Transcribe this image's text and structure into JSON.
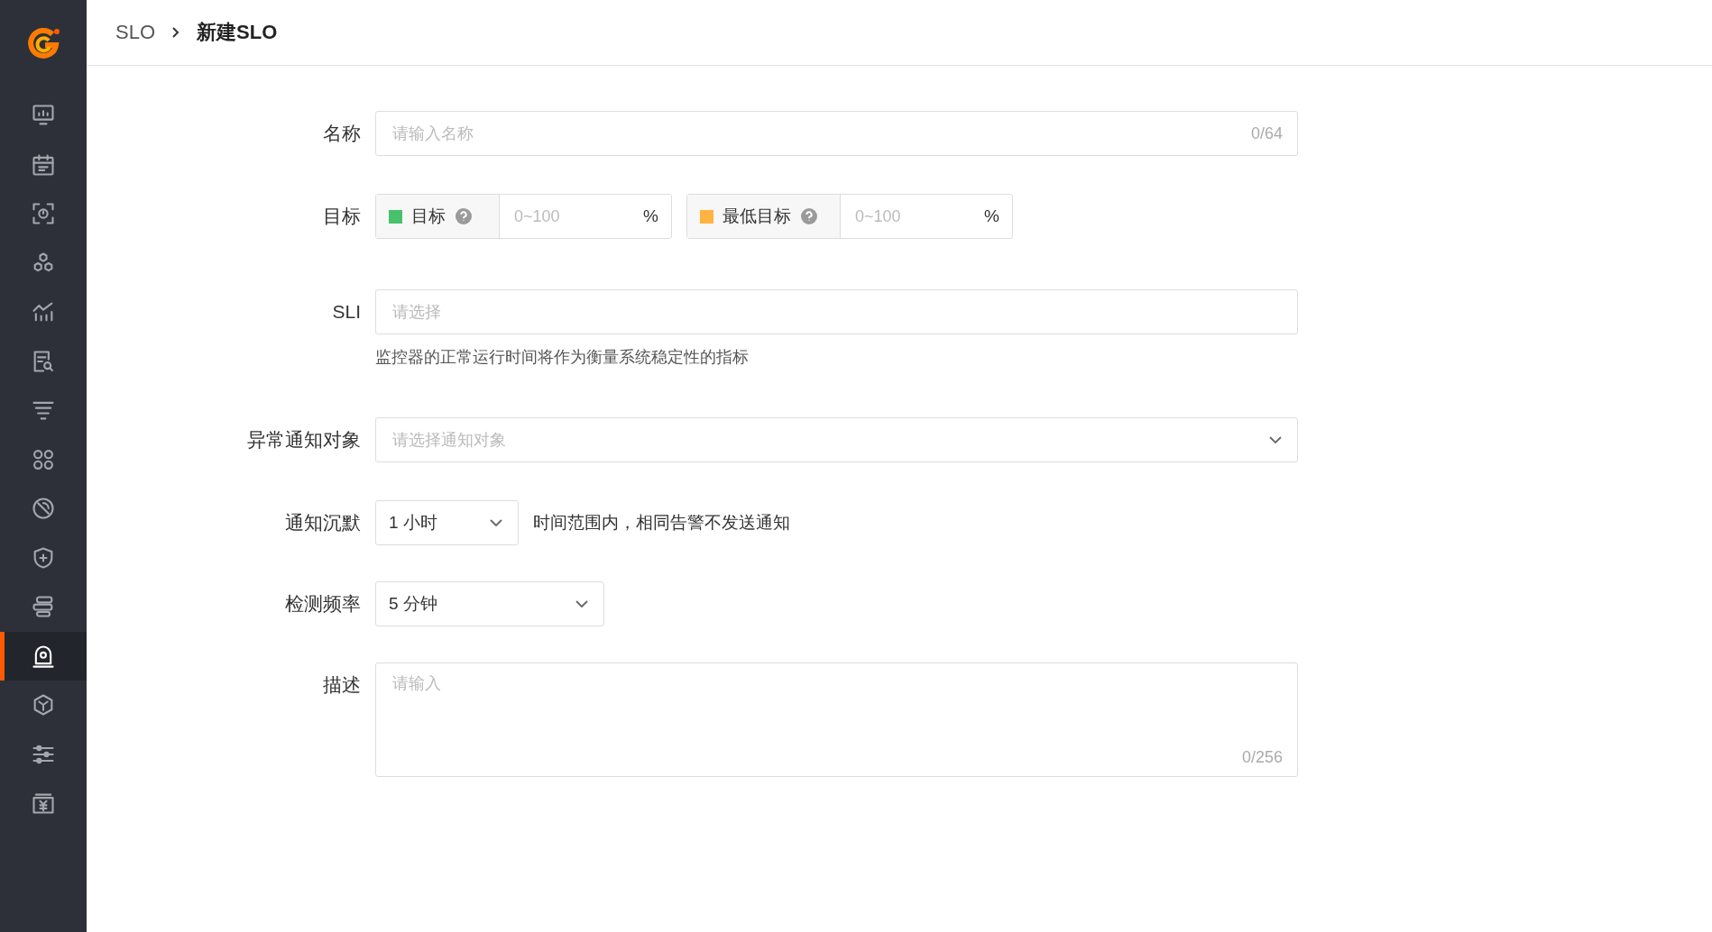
{
  "sidebar": {
    "items": [
      {
        "kind": "monitor",
        "selected": false
      },
      {
        "kind": "calendar",
        "selected": false
      },
      {
        "kind": "scan",
        "selected": false
      },
      {
        "kind": "hexagons",
        "selected": false
      },
      {
        "kind": "chart",
        "selected": false
      },
      {
        "kind": "doc-search",
        "selected": false
      },
      {
        "kind": "filter",
        "selected": false
      },
      {
        "kind": "grid",
        "selected": false
      },
      {
        "kind": "radar",
        "selected": false
      },
      {
        "kind": "shield",
        "selected": false
      },
      {
        "kind": "server",
        "selected": false
      },
      {
        "kind": "webcam",
        "selected": true
      },
      {
        "kind": "cube",
        "selected": false
      },
      {
        "kind": "sliders",
        "selected": false
      },
      {
        "kind": "yen",
        "selected": false
      }
    ]
  },
  "breadcrumb": [
    {
      "label": "SLO",
      "current": false
    },
    {
      "label": "新建SLO",
      "current": true
    }
  ],
  "form": {
    "fields": [
      {
        "kind": "text",
        "label": "名称",
        "placeholder": "请输入名称",
        "counter": "0/64"
      },
      {
        "kind": "targets",
        "label": "目标",
        "targets": [
          {
            "label": "目标",
            "color": "#47c26b",
            "placeholder": "0~100",
            "unit": "%"
          },
          {
            "label": "最低目标",
            "color": "#ffb340",
            "placeholder": "0~100",
            "unit": "%"
          }
        ]
      },
      {
        "kind": "combo",
        "label": "SLI",
        "placeholder": "请选择",
        "hint": "监控器的正常运行时间将作为衡量系统稳定性的指标"
      },
      {
        "kind": "select",
        "label": "异常通知对象",
        "placeholder": "请选择通知对象"
      },
      {
        "kind": "dropdown",
        "label": "通知沉默",
        "value": "1 小时",
        "note": "时间范围内，相同告警不发送通知"
      },
      {
        "kind": "dropdown",
        "label": "检测频率",
        "value": "5 分钟"
      },
      {
        "kind": "textarea",
        "label": "描述",
        "placeholder": "请输入",
        "counter": "0/256"
      }
    ]
  }
}
